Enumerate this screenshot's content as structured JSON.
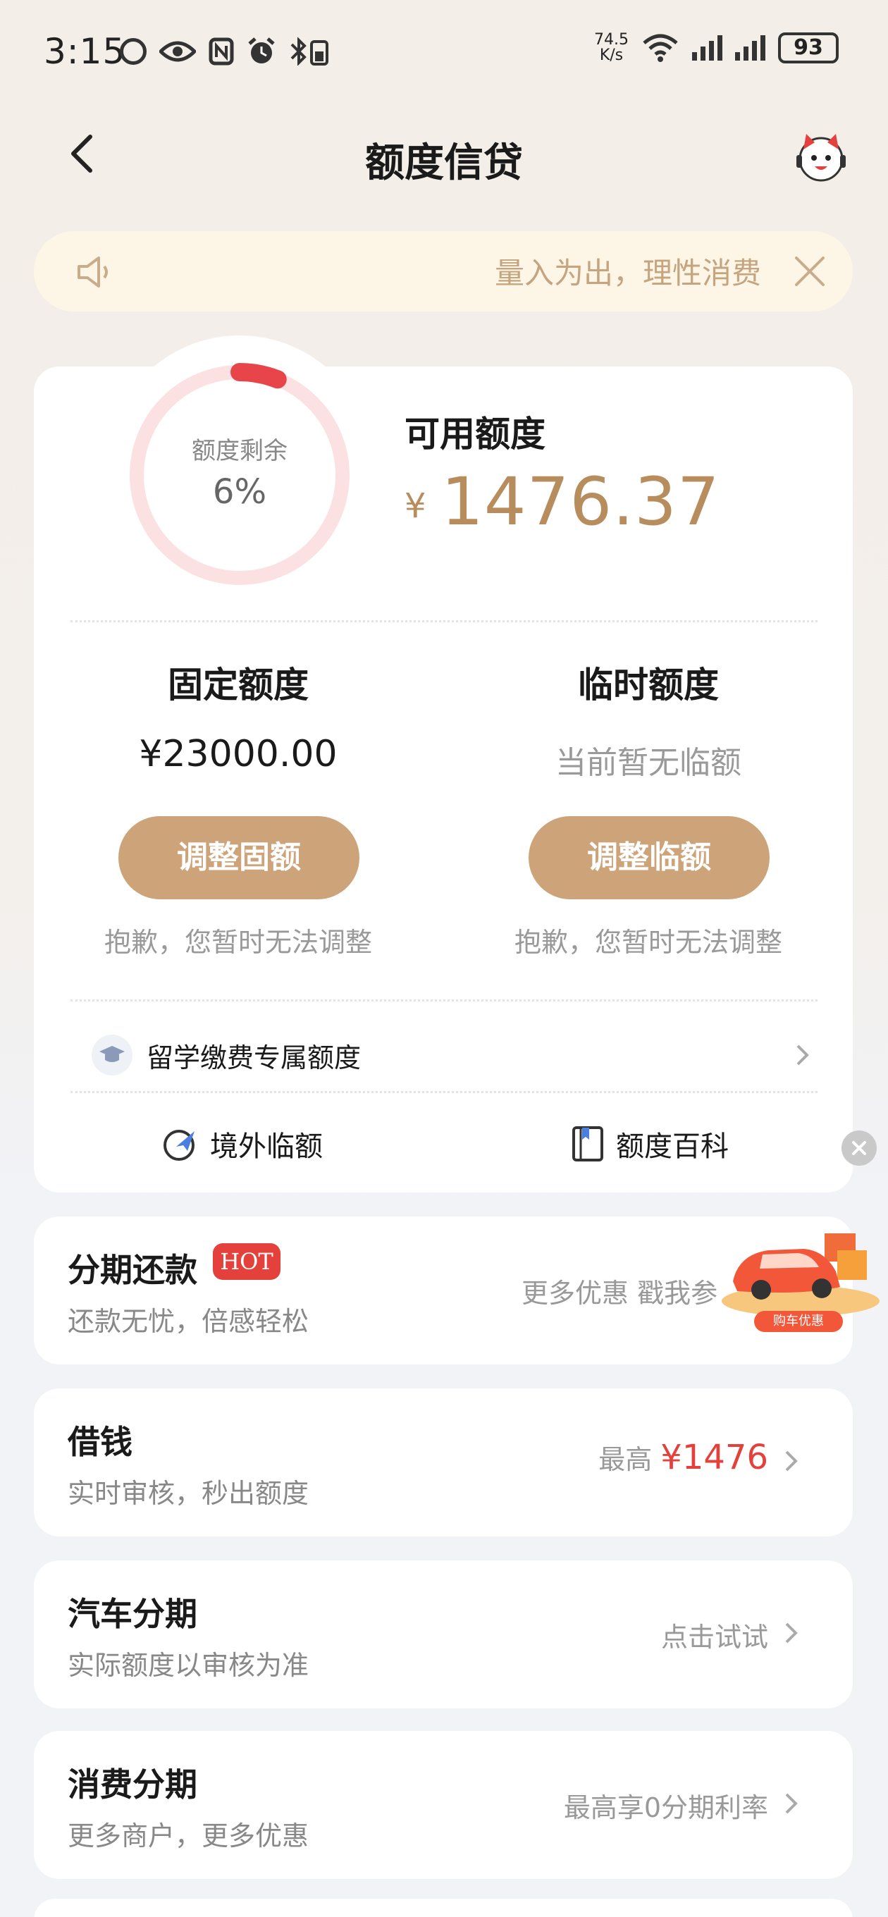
{
  "status_bar": {
    "time": "3:15",
    "net_speed_value": "74.5",
    "net_speed_unit": "K/s",
    "battery": "93"
  },
  "header": {
    "title": "额度信贷"
  },
  "notice": {
    "text": "量入为出，理性消费"
  },
  "credit": {
    "ring_label": "额度剩余",
    "ring_percent": "6%",
    "ring_fraction": 0.06,
    "available_label": "可用额度",
    "currency": "¥",
    "available_amount": "1476.37",
    "fixed": {
      "title": "固定额度",
      "value": "¥23000.00",
      "button": "调整固额",
      "note": "抱歉，您暂时无法调整"
    },
    "temp": {
      "title": "临时额度",
      "value": "当前暂无临额",
      "button": "调整临额",
      "note": "抱歉，您暂时无法调整"
    },
    "study_abroad": "留学缴费专属额度",
    "tools": {
      "overseas": "境外临额",
      "wiki": "额度百科"
    }
  },
  "list": [
    {
      "title": "分期还款",
      "badge": "HOT",
      "subtitle": "还款无忧，倍感轻松",
      "right": "更多优惠 戳我参"
    },
    {
      "title": "借钱",
      "subtitle": "实时审核，秒出额度",
      "right_prefix": "最高",
      "right_value": "¥1476"
    },
    {
      "title": "汽车分期",
      "subtitle": "实际额度以审核为准",
      "right": "点击试试"
    },
    {
      "title": "消费分期",
      "subtitle": "更多商户，更多优惠",
      "right": "最高享0分期利率"
    }
  ],
  "promo": {
    "label": "购车优惠"
  },
  "colors": {
    "accent_gold": "#cda47a",
    "amount_gold": "#b88d5e",
    "hot_red": "#e5413c",
    "ring_track": "#fbe1e1",
    "ring_fill": "#e8454a"
  }
}
